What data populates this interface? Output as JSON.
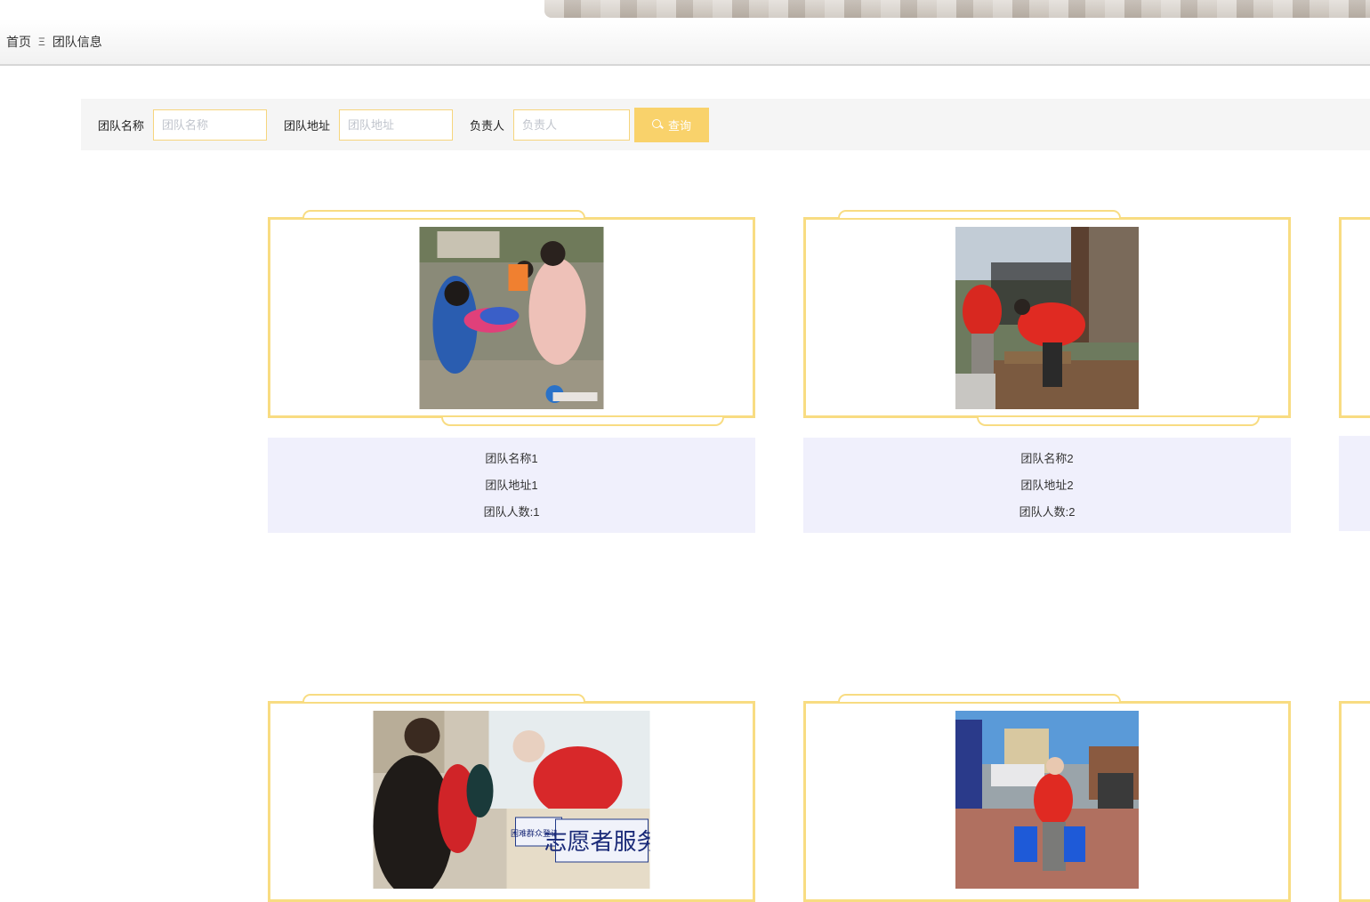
{
  "breadcrumb": {
    "home": "首页",
    "separator": "Ξ",
    "current": "团队信息"
  },
  "search": {
    "name_label": "团队名称",
    "name_placeholder": "团队名称",
    "address_label": "团队地址",
    "address_placeholder": "团队地址",
    "leader_label": "负责人",
    "leader_placeholder": "负责人",
    "button_label": "查询"
  },
  "teams": [
    {
      "name": "团队名称1",
      "address": "团队地址1",
      "members": "团队人数:1"
    },
    {
      "name": "团队名称2",
      "address": "团队地址2",
      "members": "团队人数:2"
    }
  ],
  "photo_signs": {
    "volunteer_service": "志愿者服务",
    "registration_desk": "困难群众登记处"
  },
  "colors": {
    "accent": "#f9d26b",
    "frame": "#f8dc82",
    "info_bg": "#f0f0fc",
    "searchbar_bg": "#f5f5f5"
  }
}
